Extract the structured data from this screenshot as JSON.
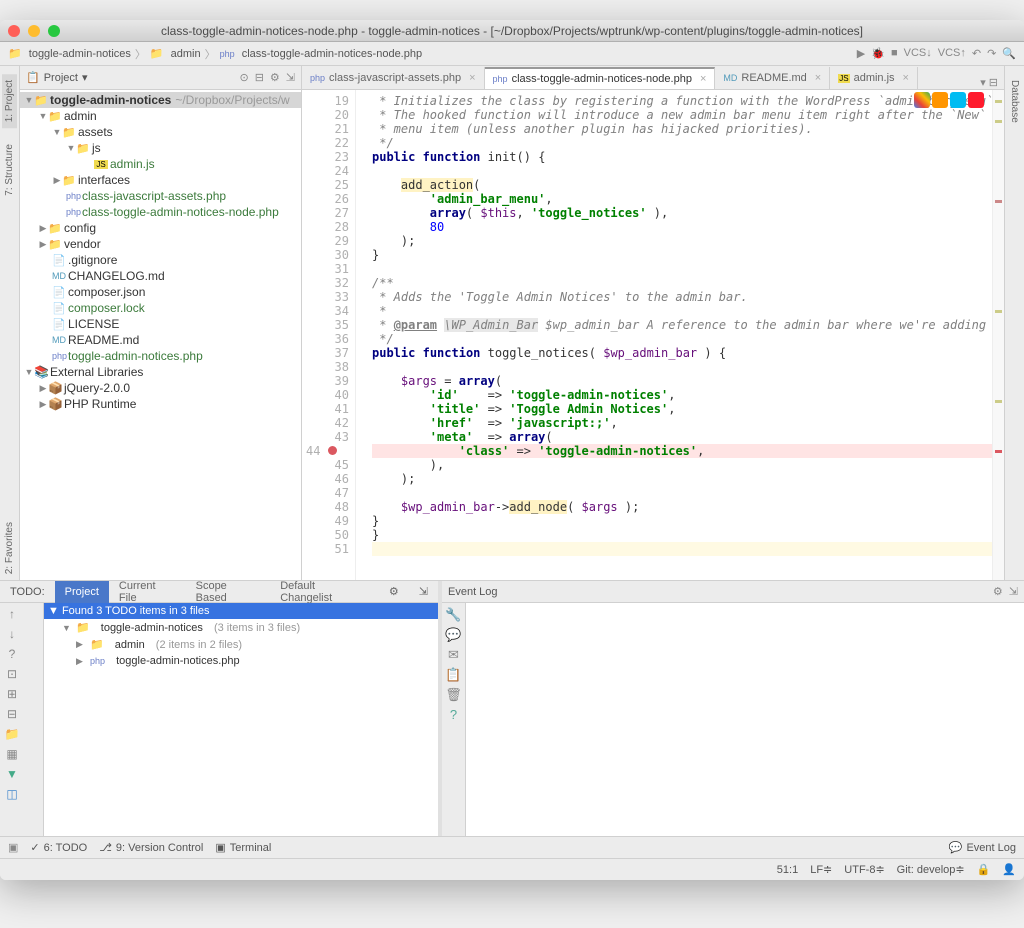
{
  "window_title": "class-toggle-admin-notices-node.php - toggle-admin-notices - [~/Dropbox/Projects/wptrunk/wp-content/plugins/toggle-admin-notices]",
  "breadcrumb": [
    "toggle-admin-notices",
    "admin",
    "class-toggle-admin-notices-node.php"
  ],
  "left_tabs": [
    "1: Project",
    "7: Structure"
  ],
  "right_tabs": [
    "Database"
  ],
  "project_panel_title": "Project",
  "project_tree": {
    "root": "toggle-admin-notices",
    "root_hint": "~/Dropbox/Projects/w",
    "admin": "admin",
    "assets": "assets",
    "js": "js",
    "admin_js": "admin.js",
    "interfaces": "interfaces",
    "class_js_assets": "class-javascript-assets.php",
    "class_node": "class-toggle-admin-notices-node.php",
    "config": "config",
    "vendor": "vendor",
    "gitignore": ".gitignore",
    "changelog": "CHANGELOG.md",
    "composer_json": "composer.json",
    "composer_lock": "composer.lock",
    "license": "LICENSE",
    "readme": "README.md",
    "plugin_php": "toggle-admin-notices.php",
    "ext_libs": "External Libraries",
    "jquery": "jQuery-2.0.0",
    "php_runtime": "PHP Runtime"
  },
  "editor_tabs": [
    {
      "label": "class-javascript-assets.php",
      "icon": "php"
    },
    {
      "label": "class-toggle-admin-notices-node.php",
      "icon": "php",
      "active": true
    },
    {
      "label": "README.md",
      "icon": "md"
    },
    {
      "label": "admin.js",
      "icon": "js"
    }
  ],
  "line_start": 19,
  "line_end": 51,
  "breakpoint_line": 44,
  "code": {
    "l19": " * Initializes the class by registering a function with the WordPress `admin_bar_menu`",
    "l20": " * The hooked function will introduce a new admin bar menu item right after the `New`",
    "l21": " * menu item (unless another plugin has hijacked priorities).",
    "l22": " */",
    "l23_kw1": "public",
    "l23_kw2": "function",
    "l23_fn": "init",
    "l23_rest": "() {",
    "l25_fn": "add_action",
    "l25_rest": "(",
    "l26_str": "'admin_bar_menu'",
    "l26_rest": ",",
    "l27_kw": "array",
    "l27_var": "$this",
    "l27_str": "'toggle_notices'",
    "l27_rest": "( ",
    "l27_rest2": ", ",
    "l27_rest3": " ),",
    "l28_num": "80",
    "l29": ");",
    "l30": "}",
    "l32": "/**",
    "l33": " * Adds the 'Toggle Admin Notices' to the admin bar.",
    "l34": " *",
    "l35_tag": "@param",
    "l35_type": "\\WP_Admin_Bar",
    "l35_rest": " $wp_admin_bar A reference to the admin bar where we're adding a",
    "l36": " */",
    "l37_kw1": "public",
    "l37_kw2": "function",
    "l37_fn": "toggle_notices",
    "l37_var": "$wp_admin_bar",
    "l37_rest": "( ",
    "l37_rest2": " ) {",
    "l39_var": "$args",
    "l39_kw": "array",
    "l39_rest": " = ",
    "l39_rest2": "(",
    "l40_k": "'id'",
    "l40_v": "'toggle-admin-notices'",
    "l40_arrow": "    => ",
    "l41_k": "'title'",
    "l41_v": "'Toggle Admin Notices'",
    "l41_arrow": " => ",
    "l42_k": "'href'",
    "l42_v": "'javascript:;'",
    "l42_arrow": "  => ",
    "l43_k": "'meta'",
    "l43_kw": "array",
    "l43_arrow": "  => ",
    "l43_rest": "(",
    "l44_k": "'class'",
    "l44_v": "'toggle-admin-notices'",
    "l44_arrow": " => ",
    "l45": "),",
    "l46": ");",
    "l48_var": "$wp_admin_bar",
    "l48_fn": "add_node",
    "l48_var2": "$args",
    "l48_rest": "->",
    "l48_rest2": "( ",
    "l48_rest3": " );",
    "l49": "}",
    "l50": "}"
  },
  "todo": {
    "label": "TODO:",
    "tabs": [
      "Project",
      "Current File",
      "Scope Based",
      "Default Changelist"
    ],
    "header": "Found 3 TODO items in 3 files",
    "root": "toggle-admin-notices",
    "root_hint": "(3 items in 3 files)",
    "admin": "admin",
    "admin_hint": "(2 items in 2 files)",
    "file": "toggle-admin-notices.php"
  },
  "event_log_title": "Event Log",
  "bottom_tools": [
    "6: TODO",
    "9: Version Control",
    "Terminal"
  ],
  "status": {
    "pos": "51:1",
    "lf": "LF≑",
    "enc": "UTF-8≑",
    "git": "Git: develop≑"
  },
  "left_fav": "2: Favorites"
}
